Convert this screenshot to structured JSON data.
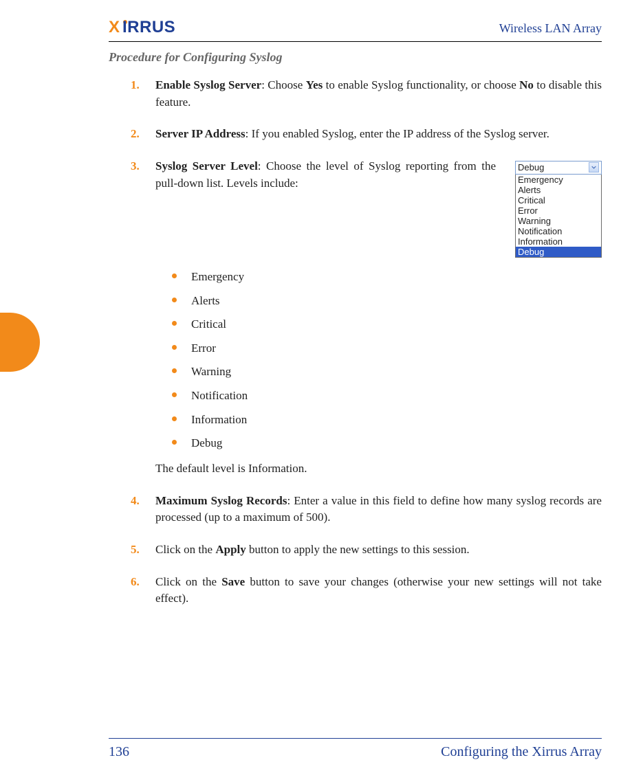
{
  "header": {
    "logo_text": "XIRRUS",
    "doc_title": "Wireless LAN Array"
  },
  "section_title": "Procedure for Configuring Syslog",
  "steps": [
    {
      "num": "1.",
      "lead": "Enable Syslog Server",
      "rest": ": Choose ",
      "bold1": "Yes",
      "rest2": " to enable Syslog functionality, or choose ",
      "bold2": "No",
      "rest3": " to disable this feature."
    },
    {
      "num": "2.",
      "lead": "Server IP Address",
      "rest": ": If you enabled Syslog, enter the IP address of the Syslog server."
    },
    {
      "num": "3.",
      "lead": "Syslog Server Level",
      "rest": ": Choose the level of Syslog reporting from the pull-down list. Levels include:",
      "bullets": [
        "Emergency",
        "Alerts",
        "Critical",
        "Error",
        "Warning",
        "Notification",
        "Information",
        "Debug"
      ],
      "trailing": "The default level is Information."
    },
    {
      "num": "4.",
      "lead": "Maximum Syslog Records",
      "rest": ": Enter a value in this field to define how many syslog records are processed (up to a maximum of 500)."
    },
    {
      "num": "5.",
      "pre": "Click on the ",
      "bold1": "Apply",
      "post": " button to apply the new settings to this session."
    },
    {
      "num": "6.",
      "pre": "Click on the ",
      "bold1": "Save",
      "post": " button to save your changes (otherwise your new settings will not take effect)."
    }
  ],
  "dropdown": {
    "selected": "Debug",
    "options": [
      "Emergency",
      "Alerts",
      "Critical",
      "Error",
      "Warning",
      "Notification",
      "Information",
      "Debug"
    ],
    "highlighted_index": 7
  },
  "footer": {
    "page_number": "136",
    "section": "Configuring the Xirrus Array"
  }
}
